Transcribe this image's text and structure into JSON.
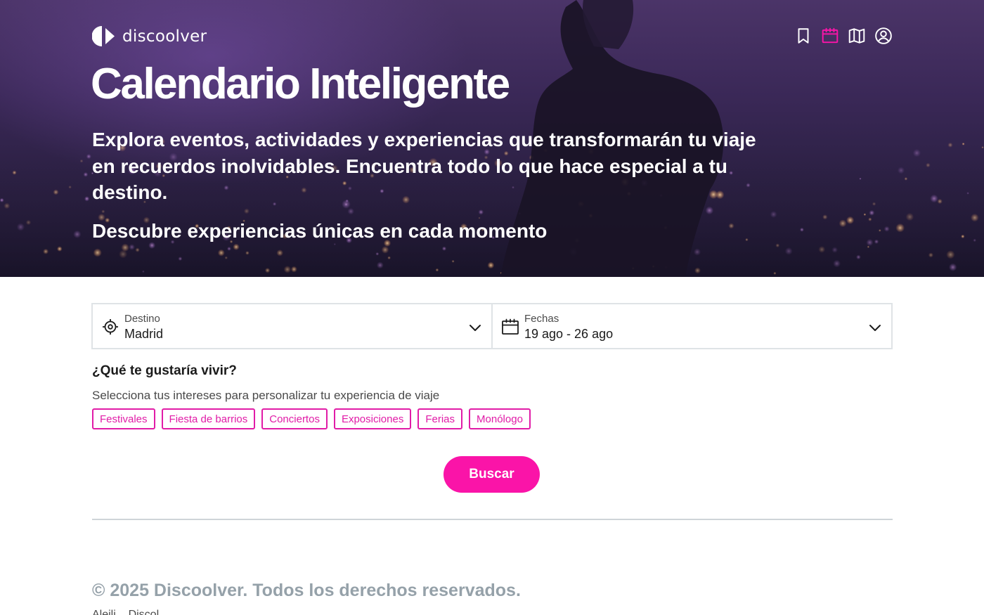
{
  "brand": {
    "name": "discoolver",
    "accent_color": "#fa14a8",
    "chip_color": "#e11ca7"
  },
  "nav": {
    "icons": [
      {
        "name": "bookmark-icon",
        "active": false
      },
      {
        "name": "calendar-icon",
        "active": true
      },
      {
        "name": "map-icon",
        "active": false
      },
      {
        "name": "user-icon",
        "active": false
      }
    ]
  },
  "hero": {
    "title": "Calendario Inteligente",
    "description": "Explora eventos, actividades y experiencias que transformarán tu viaje en recuerdos inolvidables. Encuentra todo lo que hace especial a tu destino.",
    "subtitle": "Descubre experiencias únicas en cada momento"
  },
  "search": {
    "destination": {
      "label": "Destino",
      "value": "Madrid",
      "icon": "crosshair-icon"
    },
    "dates": {
      "label": "Fechas",
      "value": "19 ago - 26 ago",
      "icon": "calendar-icon"
    },
    "interests_title": "¿Qué te gustaría vivir?",
    "interests_subtitle": "Selecciona tus intereses para personalizar tu experiencia de viaje",
    "interests": [
      "Festivales",
      "Fiesta de barrios",
      "Conciertos",
      "Exposiciones",
      "Ferias",
      "Monólogo"
    ],
    "button_label": "Buscar"
  },
  "footer": {
    "copyright": "© 2025 Discoolver. Todos los derechos reservados.",
    "link_partial": "Aleili... Discol..."
  }
}
